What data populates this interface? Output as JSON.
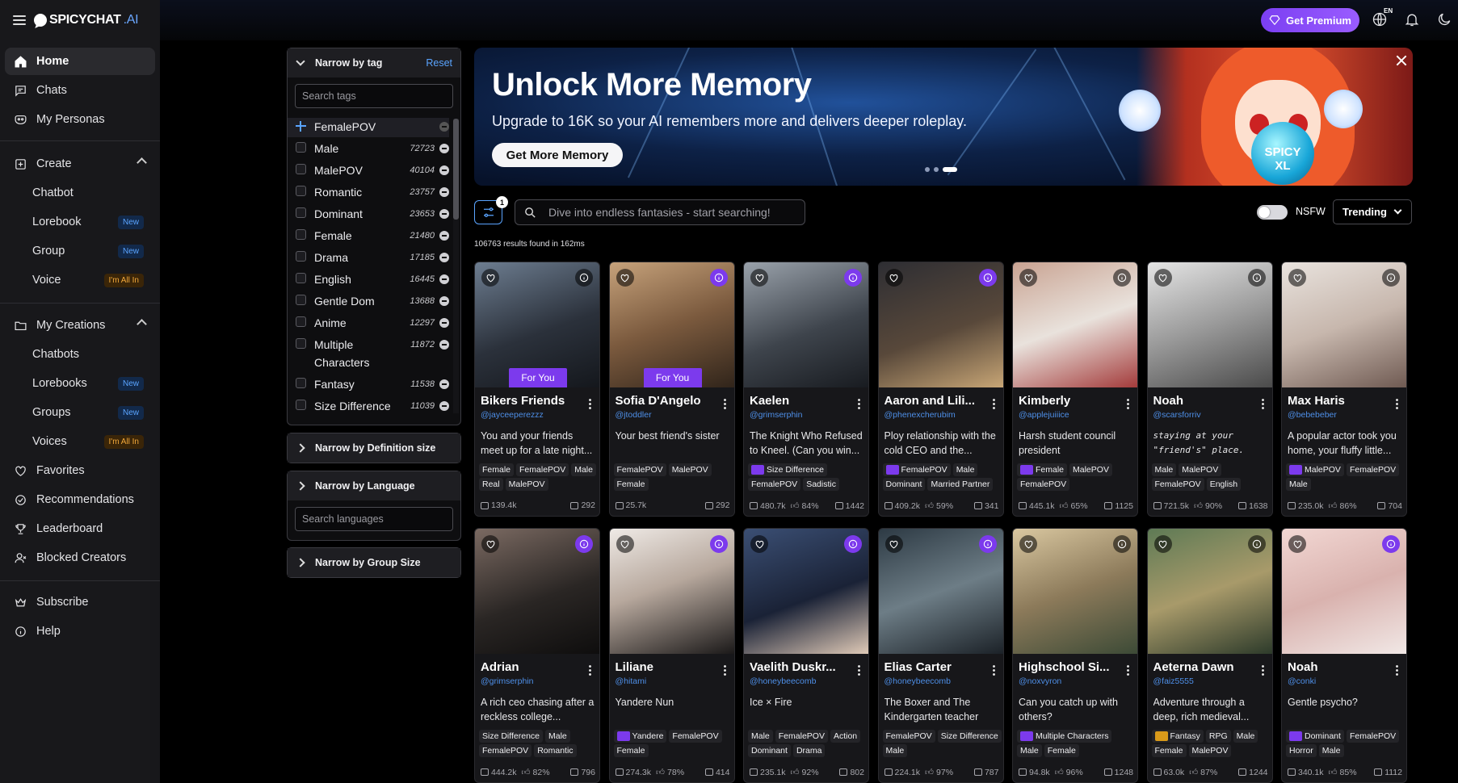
{
  "logo": {
    "brand": "SPICYCHAT",
    "suffix": ".AI"
  },
  "sidebar": {
    "items": [
      {
        "label": "Home",
        "icon": "home-icon"
      },
      {
        "label": "Chats",
        "icon": "chat-icon"
      },
      {
        "label": "My Personas",
        "icon": "persona-icon"
      },
      {
        "label": "Create",
        "icon": "plus-square-icon"
      },
      {
        "label": "Chatbot"
      },
      {
        "label": "Lorebook",
        "badge": "New"
      },
      {
        "label": "Group",
        "badge": "New"
      },
      {
        "label": "Voice",
        "badge": "I'm All In"
      },
      {
        "label": "My Creations",
        "icon": "folder-icon"
      },
      {
        "label": "Chatbots"
      },
      {
        "label": "Lorebooks",
        "badge": "New"
      },
      {
        "label": "Groups",
        "badge": "New"
      },
      {
        "label": "Voices",
        "badge": "I'm All In"
      },
      {
        "label": "Favorites",
        "icon": "heart-icon"
      },
      {
        "label": "Recommendations",
        "icon": "check-circle-icon"
      },
      {
        "label": "Leaderboard",
        "icon": "trophy-icon"
      },
      {
        "label": "Blocked Creators",
        "icon": "blocked-user-icon"
      },
      {
        "label": "Subscribe",
        "icon": "crown-icon"
      },
      {
        "label": "Help",
        "icon": "info-icon"
      }
    ]
  },
  "header": {
    "premium_label": "Get Premium",
    "language_code": "EN"
  },
  "filters": {
    "tag_panel": {
      "title": "Narrow by tag",
      "reset_label": "Reset",
      "search_placeholder": "Search tags",
      "selected": "FemalePOV",
      "tags": [
        {
          "name": "Male",
          "count": "72723"
        },
        {
          "name": "MalePOV",
          "count": "40104"
        },
        {
          "name": "Romantic",
          "count": "23757"
        },
        {
          "name": "Dominant",
          "count": "23653"
        },
        {
          "name": "Female",
          "count": "21480"
        },
        {
          "name": "Drama",
          "count": "17185"
        },
        {
          "name": "English",
          "count": "16445"
        },
        {
          "name": "Gentle Dom",
          "count": "13688"
        },
        {
          "name": "Anime",
          "count": "12297"
        },
        {
          "name": "Multiple Characters",
          "count": "11872"
        },
        {
          "name": "Fantasy",
          "count": "11538"
        },
        {
          "name": "Size Difference",
          "count": "11039"
        }
      ]
    },
    "definition_panel": {
      "title": "Narrow by Definition size"
    },
    "language_panel": {
      "title": "Narrow by Language",
      "search_placeholder": "Search languages"
    },
    "group_panel": {
      "title": "Narrow by Group Size"
    }
  },
  "banner": {
    "title": "Unlock More Memory",
    "subtitle": "Upgrade to 16K so your AI remembers more and delivers deeper roleplay.",
    "cta_label": "Get More Memory",
    "orb_text": "SPICY XL",
    "slide_count": 3,
    "active_slide": 3
  },
  "search": {
    "placeholder": "Dive into endless fantasies - start searching!",
    "filter_count": "1",
    "nsfw_label": "NSFW",
    "sort_label": "Trending",
    "results_text": "106763 results found in 162ms"
  },
  "colors": {
    "accent": "#7c3aed",
    "link": "#4e8fe8",
    "new_badge": "#5aa4ff",
    "allin_badge": "#f3a93b"
  },
  "cards": [
    {
      "name": "Bikers Friends",
      "author": "@jayceeperezzz",
      "desc": "You and your friends meet up for a late night...",
      "for_you": "For You",
      "tags": [
        "Female",
        "FemalePOV",
        "Male",
        "Real",
        "MalePOV"
      ],
      "chats": "139.4k",
      "rating": "",
      "tokens": "292",
      "info": "dark"
    },
    {
      "name": "Sofia D'Angelo",
      "author": "@jtoddler",
      "desc": "Your best friend's sister",
      "for_you": "For You",
      "tags": [
        "FemalePOV",
        "MalePOV",
        "Female"
      ],
      "chats": "25.7k",
      "rating": "",
      "tokens": "292",
      "info": "purple"
    },
    {
      "name": "Kaelen",
      "author": "@grimserphin",
      "desc": "The Knight Who Refused to Kneel. (Can you win...",
      "tags": [
        "#Size Difference",
        "FemalePOV",
        "Sadistic"
      ],
      "chats": "480.7k",
      "rating": "84%",
      "tokens": "1442",
      "info": "purple"
    },
    {
      "name": "Aaron and Lili...",
      "author": "@phenexcherubim",
      "desc": "Ploy relationship with the cold CEO and the...",
      "tags": [
        "#FemalePOV",
        "Male",
        "Dominant",
        "Married Partner"
      ],
      "chats": "409.2k",
      "rating": "59%",
      "tokens": "341",
      "info": "purple"
    },
    {
      "name": "Kimberly",
      "author": "@applejuiiice",
      "desc": "Harsh student council president",
      "tags": [
        "#Female",
        "MalePOV",
        "FemalePOV"
      ],
      "chats": "445.1k",
      "rating": "65%",
      "tokens": "1125",
      "info": "dark"
    },
    {
      "name": "Noah",
      "author": "@scarsforriv",
      "desc": "staying at your \"friend's\" place. |...",
      "desc_italic": true,
      "tags": [
        "Male",
        "MalePOV",
        "FemalePOV",
        "English"
      ],
      "chats": "721.5k",
      "rating": "90%",
      "tokens": "1638",
      "info": "dark"
    },
    {
      "name": "Max Haris",
      "author": "@bebebeber",
      "desc": "A popular actor took you home, your fluffy little...",
      "tags": [
        "#MalePOV",
        "FemalePOV",
        "Male"
      ],
      "chats": "235.0k",
      "rating": "86%",
      "tokens": "704",
      "info": "dark"
    },
    {
      "name": "Adrian",
      "author": "@grimserphin",
      "desc": "A rich ceo chasing after a reckless college...",
      "tags": [
        "Size Difference",
        "Male",
        "FemalePOV",
        "Romantic"
      ],
      "chats": "444.2k",
      "rating": "82%",
      "tokens": "796",
      "info": "purple"
    },
    {
      "name": "Liliane",
      "author": "@hitami",
      "desc": "Yandere Nun",
      "tags": [
        "#Yandere",
        "FemalePOV",
        "Female"
      ],
      "chats": "274.3k",
      "rating": "78%",
      "tokens": "414",
      "info": "purple"
    },
    {
      "name": "Vaelith Duskr...",
      "author": "@honeybeecomb",
      "desc": "Ice × Fire",
      "tags": [
        "Male",
        "FemalePOV",
        "Action",
        "Dominant",
        "Drama"
      ],
      "chats": "235.1k",
      "rating": "92%",
      "tokens": "802",
      "info": "purple"
    },
    {
      "name": "Elias Carter",
      "author": "@honeybeecomb",
      "desc": "The Boxer and The Kindergarten teacher",
      "tags": [
        "FemalePOV",
        "Size Difference",
        "Male"
      ],
      "chats": "224.1k",
      "rating": "97%",
      "tokens": "787",
      "info": "purple"
    },
    {
      "name": "Highschool Si...",
      "author": "@noxvyron",
      "desc": "Can you catch up with others?",
      "tags": [
        "#Multiple Characters",
        "Male",
        "Female"
      ],
      "chats": "94.8k",
      "rating": "96%",
      "tokens": "1248",
      "info": "dark"
    },
    {
      "name": "Aeterna Dawn",
      "author": "@faiz5555",
      "desc": "Adventure through a deep, rich medieval...",
      "tags": [
        "*Fantasy",
        "RPG",
        "Male",
        "Female",
        "MalePOV"
      ],
      "chats": "63.0k",
      "rating": "87%",
      "tokens": "1244",
      "info": "dark"
    },
    {
      "name": "Noah",
      "author": "@conki",
      "desc": "Gentle psycho?",
      "tags": [
        "#Dominant",
        "FemalePOV",
        "Horror",
        "Male"
      ],
      "chats": "340.1k",
      "rating": "85%",
      "tokens": "1112",
      "info": "purple"
    }
  ]
}
